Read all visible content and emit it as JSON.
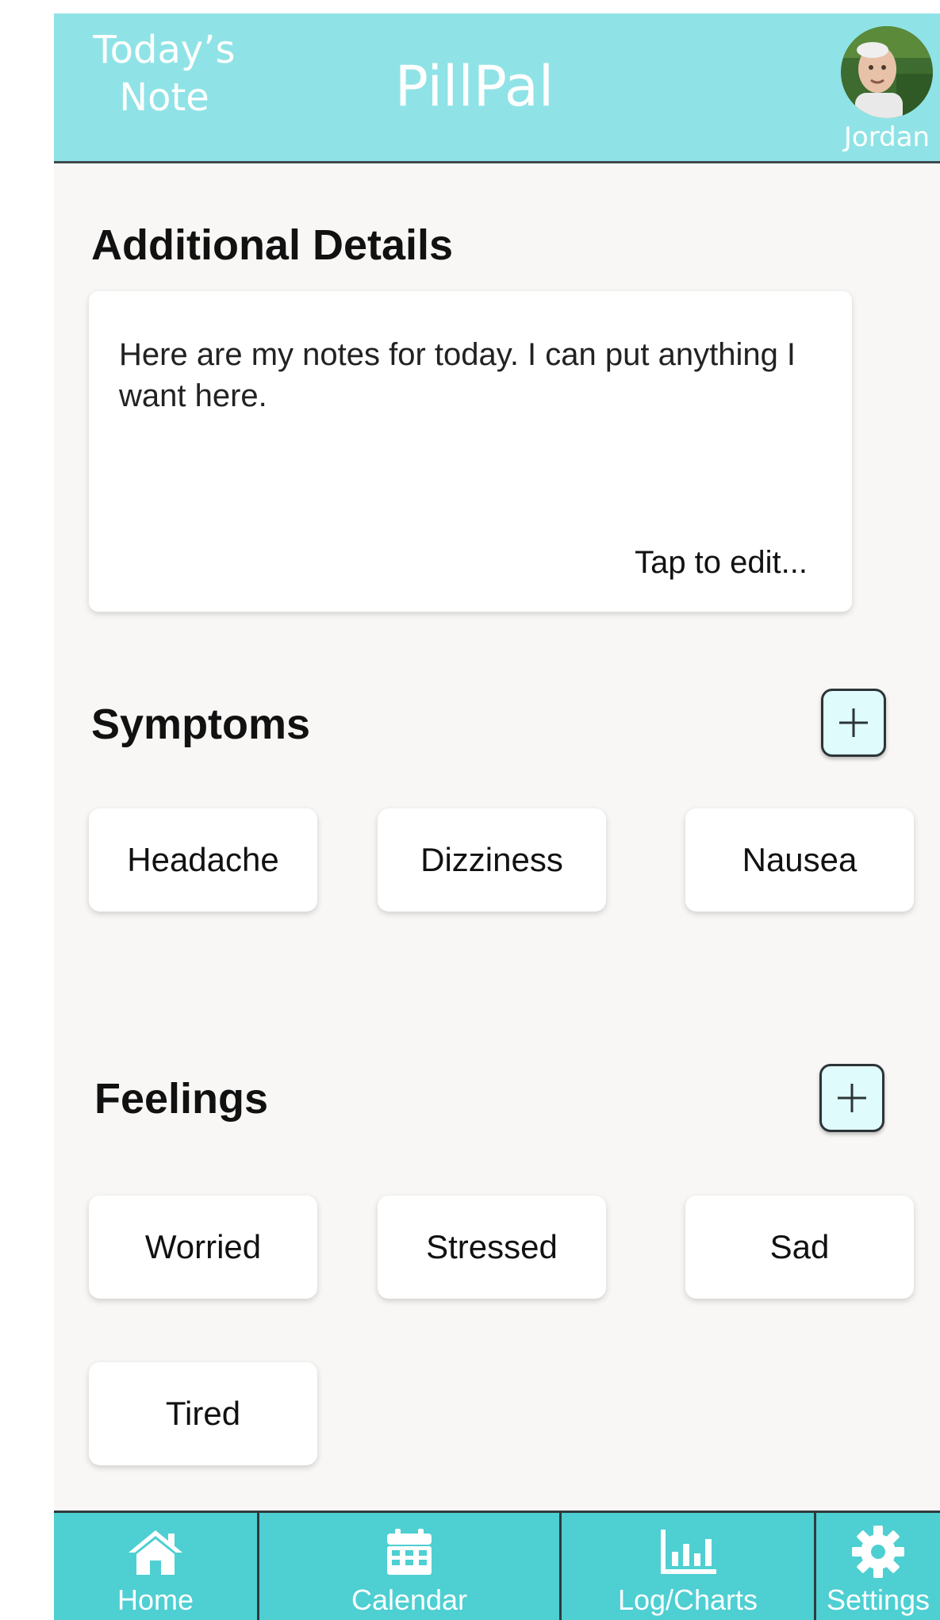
{
  "header": {
    "left_title_line1": "Today’s",
    "left_title_line2": "Note",
    "app_title": "PillPal",
    "user_name": "Jordan"
  },
  "additional_details": {
    "title": "Additional Details",
    "notes": "Here are my notes for today. I can put anything I want here.",
    "edit_hint": "Tap to edit..."
  },
  "symptoms": {
    "title": "Symptoms",
    "items": [
      "Headache",
      "Dizziness",
      "Nausea"
    ]
  },
  "feelings": {
    "title": "Feelings",
    "items": [
      "Worried",
      "Stressed",
      "Sad",
      "Tired"
    ]
  },
  "bottom_nav": {
    "items": [
      {
        "label": "Home",
        "icon": "home-icon"
      },
      {
        "label": "Calendar",
        "icon": "calendar-icon"
      },
      {
        "label": "Log/Charts",
        "icon": "bar-chart-icon"
      },
      {
        "label": "Settings",
        "icon": "gear-icon"
      }
    ]
  },
  "colors": {
    "header_bg": "#8fe3e6",
    "nav_bg": "#4ecfd2",
    "page_bg": "#f8f7f5",
    "add_button_bg": "#dffbfc"
  }
}
